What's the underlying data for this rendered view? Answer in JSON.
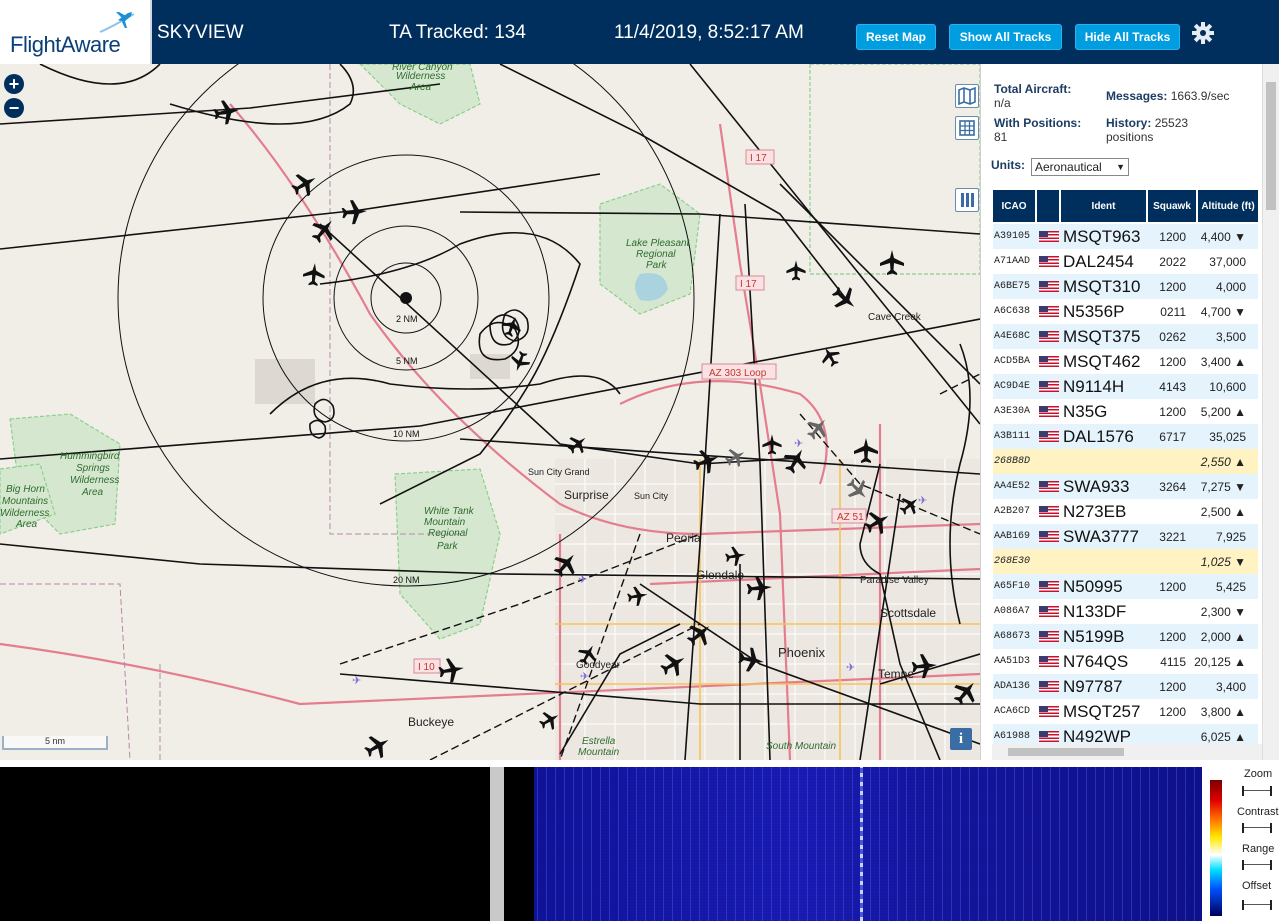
{
  "header": {
    "logo_text": "FlightAware",
    "app_name": "SKYVIEW",
    "tracked": "TA Tracked: 134",
    "datetime": "11/4/2019, 8:52:17 AM",
    "buttons": {
      "reset_map": "Reset Map",
      "show_all_tracks": "Show All Tracks",
      "hide_all_tracks": "Hide All Tracks"
    },
    "accent": "#009de0",
    "bar_color": "#002f5d"
  },
  "map": {
    "zoom_in": "+",
    "zoom_out": "−",
    "scale": "5 nm",
    "range_rings": [
      "2 NM",
      "5 NM",
      "10 NM",
      "20 NM"
    ],
    "places": [
      "River Canyon Wilderness Area",
      "Lake Pleasant Regional Park",
      "Cave Creek",
      "AZ 303 Loop",
      "Sun City Grand",
      "Surprise",
      "Sun City",
      "Peoria",
      "Glendale",
      "Paradise Valley",
      "Scottsdale",
      "Phoenix",
      "Tempe",
      "Goodyear",
      "Buckeye",
      "Estrella Mountain Regional Park",
      "South Mountain Preserve",
      "White Tank Mountain Regional Park",
      "Hummingbird Springs Wilderness Area",
      "Big Horn Mountains Wilderness Area",
      "I 17",
      "I 10",
      "AZ 51"
    ],
    "info": "i"
  },
  "stats": {
    "total_aircraft_label": "Total Aircraft:",
    "total_aircraft_value": "n/a",
    "with_positions_label": "With Positions:",
    "with_positions_value": "81",
    "messages_label": "Messages:",
    "messages_value": "1663.9/sec",
    "history_label": "History:",
    "history_value": "25523",
    "history_unit": "positions",
    "units_label": "Units:",
    "units_value": "Aeronautical"
  },
  "table": {
    "headers": {
      "icao": "ICAO",
      "ident": "Ident",
      "squawk": "Squawk",
      "altitude": "Altitude (ft)"
    },
    "rows": [
      {
        "icao": "A39105",
        "flag": true,
        "ident": "MSQT963",
        "squawk": "1200",
        "alt": "4,400 ▼"
      },
      {
        "icao": "A71AAD",
        "flag": true,
        "ident": "DAL2454",
        "squawk": "2022",
        "alt": "37,000"
      },
      {
        "icao": "A6BE75",
        "flag": true,
        "ident": "MSQT310",
        "squawk": "1200",
        "alt": "4,000"
      },
      {
        "icao": "A6C638",
        "flag": true,
        "ident": "N5356P",
        "squawk": "0211",
        "alt": "4,700 ▼"
      },
      {
        "icao": "A4E68C",
        "flag": true,
        "ident": "MSQT375",
        "squawk": "0262",
        "alt": "3,500"
      },
      {
        "icao": "ACD5BA",
        "flag": true,
        "ident": "MSQT462",
        "squawk": "1200",
        "alt": "3,400 ▲"
      },
      {
        "icao": "AC9D4E",
        "flag": true,
        "ident": "N9114H",
        "squawk": "4143",
        "alt": "10,600"
      },
      {
        "icao": "A3E30A",
        "flag": true,
        "ident": "N35G",
        "squawk": "1200",
        "alt": "5,200 ▲"
      },
      {
        "icao": "A3B111",
        "flag": true,
        "ident": "DAL1576",
        "squawk": "6717",
        "alt": "35,025"
      },
      {
        "icao": "268B8D",
        "flag": false,
        "ident": "",
        "squawk": "",
        "alt": "2,550 ▲",
        "highlight": true
      },
      {
        "icao": "AA4E52",
        "flag": true,
        "ident": "SWA933",
        "squawk": "3264",
        "alt": "7,275 ▼"
      },
      {
        "icao": "A2B207",
        "flag": true,
        "ident": "N273EB",
        "squawk": "",
        "alt": "2,500 ▲"
      },
      {
        "icao": "AAB169",
        "flag": true,
        "ident": "SWA3777",
        "squawk": "3221",
        "alt": "7,925"
      },
      {
        "icao": "268E30",
        "flag": false,
        "ident": "",
        "squawk": "",
        "alt": "1,025 ▼",
        "highlight": true
      },
      {
        "icao": "A65F10",
        "flag": true,
        "ident": "N50995",
        "squawk": "1200",
        "alt": "5,425"
      },
      {
        "icao": "A086A7",
        "flag": true,
        "ident": "N133DF",
        "squawk": "",
        "alt": "2,300 ▼"
      },
      {
        "icao": "A68673",
        "flag": true,
        "ident": "N5199B",
        "squawk": "1200",
        "alt": "2,000 ▲"
      },
      {
        "icao": "AA51D3",
        "flag": true,
        "ident": "N764QS",
        "squawk": "4115",
        "alt": "20,125 ▲"
      },
      {
        "icao": "ADA136",
        "flag": true,
        "ident": "N97787",
        "squawk": "1200",
        "alt": "3,400"
      },
      {
        "icao": "ACA6CD",
        "flag": true,
        "ident": "MSQT257",
        "squawk": "1200",
        "alt": "3,800 ▲"
      },
      {
        "icao": "A61988",
        "flag": true,
        "ident": "N492WP",
        "squawk": "",
        "alt": "6,025 ▲"
      }
    ]
  },
  "spectrum": {
    "controls": [
      "Zoom",
      "Contrast",
      "Range",
      "Offset"
    ]
  }
}
